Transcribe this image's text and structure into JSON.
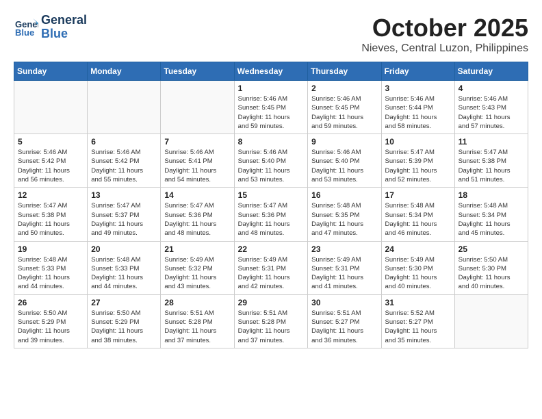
{
  "logo": {
    "line1": "General",
    "line2": "Blue"
  },
  "title": "October 2025",
  "location": "Nieves, Central Luzon, Philippines",
  "weekdays": [
    "Sunday",
    "Monday",
    "Tuesday",
    "Wednesday",
    "Thursday",
    "Friday",
    "Saturday"
  ],
  "weeks": [
    [
      {
        "day": "",
        "info": ""
      },
      {
        "day": "",
        "info": ""
      },
      {
        "day": "",
        "info": ""
      },
      {
        "day": "1",
        "info": "Sunrise: 5:46 AM\nSunset: 5:45 PM\nDaylight: 11 hours\nand 59 minutes."
      },
      {
        "day": "2",
        "info": "Sunrise: 5:46 AM\nSunset: 5:45 PM\nDaylight: 11 hours\nand 59 minutes."
      },
      {
        "day": "3",
        "info": "Sunrise: 5:46 AM\nSunset: 5:44 PM\nDaylight: 11 hours\nand 58 minutes."
      },
      {
        "day": "4",
        "info": "Sunrise: 5:46 AM\nSunset: 5:43 PM\nDaylight: 11 hours\nand 57 minutes."
      }
    ],
    [
      {
        "day": "5",
        "info": "Sunrise: 5:46 AM\nSunset: 5:42 PM\nDaylight: 11 hours\nand 56 minutes."
      },
      {
        "day": "6",
        "info": "Sunrise: 5:46 AM\nSunset: 5:42 PM\nDaylight: 11 hours\nand 55 minutes."
      },
      {
        "day": "7",
        "info": "Sunrise: 5:46 AM\nSunset: 5:41 PM\nDaylight: 11 hours\nand 54 minutes."
      },
      {
        "day": "8",
        "info": "Sunrise: 5:46 AM\nSunset: 5:40 PM\nDaylight: 11 hours\nand 53 minutes."
      },
      {
        "day": "9",
        "info": "Sunrise: 5:46 AM\nSunset: 5:40 PM\nDaylight: 11 hours\nand 53 minutes."
      },
      {
        "day": "10",
        "info": "Sunrise: 5:47 AM\nSunset: 5:39 PM\nDaylight: 11 hours\nand 52 minutes."
      },
      {
        "day": "11",
        "info": "Sunrise: 5:47 AM\nSunset: 5:38 PM\nDaylight: 11 hours\nand 51 minutes."
      }
    ],
    [
      {
        "day": "12",
        "info": "Sunrise: 5:47 AM\nSunset: 5:38 PM\nDaylight: 11 hours\nand 50 minutes."
      },
      {
        "day": "13",
        "info": "Sunrise: 5:47 AM\nSunset: 5:37 PM\nDaylight: 11 hours\nand 49 minutes."
      },
      {
        "day": "14",
        "info": "Sunrise: 5:47 AM\nSunset: 5:36 PM\nDaylight: 11 hours\nand 48 minutes."
      },
      {
        "day": "15",
        "info": "Sunrise: 5:47 AM\nSunset: 5:36 PM\nDaylight: 11 hours\nand 48 minutes."
      },
      {
        "day": "16",
        "info": "Sunrise: 5:48 AM\nSunset: 5:35 PM\nDaylight: 11 hours\nand 47 minutes."
      },
      {
        "day": "17",
        "info": "Sunrise: 5:48 AM\nSunset: 5:34 PM\nDaylight: 11 hours\nand 46 minutes."
      },
      {
        "day": "18",
        "info": "Sunrise: 5:48 AM\nSunset: 5:34 PM\nDaylight: 11 hours\nand 45 minutes."
      }
    ],
    [
      {
        "day": "19",
        "info": "Sunrise: 5:48 AM\nSunset: 5:33 PM\nDaylight: 11 hours\nand 44 minutes."
      },
      {
        "day": "20",
        "info": "Sunrise: 5:48 AM\nSunset: 5:33 PM\nDaylight: 11 hours\nand 44 minutes."
      },
      {
        "day": "21",
        "info": "Sunrise: 5:49 AM\nSunset: 5:32 PM\nDaylight: 11 hours\nand 43 minutes."
      },
      {
        "day": "22",
        "info": "Sunrise: 5:49 AM\nSunset: 5:31 PM\nDaylight: 11 hours\nand 42 minutes."
      },
      {
        "day": "23",
        "info": "Sunrise: 5:49 AM\nSunset: 5:31 PM\nDaylight: 11 hours\nand 41 minutes."
      },
      {
        "day": "24",
        "info": "Sunrise: 5:49 AM\nSunset: 5:30 PM\nDaylight: 11 hours\nand 40 minutes."
      },
      {
        "day": "25",
        "info": "Sunrise: 5:50 AM\nSunset: 5:30 PM\nDaylight: 11 hours\nand 40 minutes."
      }
    ],
    [
      {
        "day": "26",
        "info": "Sunrise: 5:50 AM\nSunset: 5:29 PM\nDaylight: 11 hours\nand 39 minutes."
      },
      {
        "day": "27",
        "info": "Sunrise: 5:50 AM\nSunset: 5:29 PM\nDaylight: 11 hours\nand 38 minutes."
      },
      {
        "day": "28",
        "info": "Sunrise: 5:51 AM\nSunset: 5:28 PM\nDaylight: 11 hours\nand 37 minutes."
      },
      {
        "day": "29",
        "info": "Sunrise: 5:51 AM\nSunset: 5:28 PM\nDaylight: 11 hours\nand 37 minutes."
      },
      {
        "day": "30",
        "info": "Sunrise: 5:51 AM\nSunset: 5:27 PM\nDaylight: 11 hours\nand 36 minutes."
      },
      {
        "day": "31",
        "info": "Sunrise: 5:52 AM\nSunset: 5:27 PM\nDaylight: 11 hours\nand 35 minutes."
      },
      {
        "day": "",
        "info": ""
      }
    ]
  ]
}
